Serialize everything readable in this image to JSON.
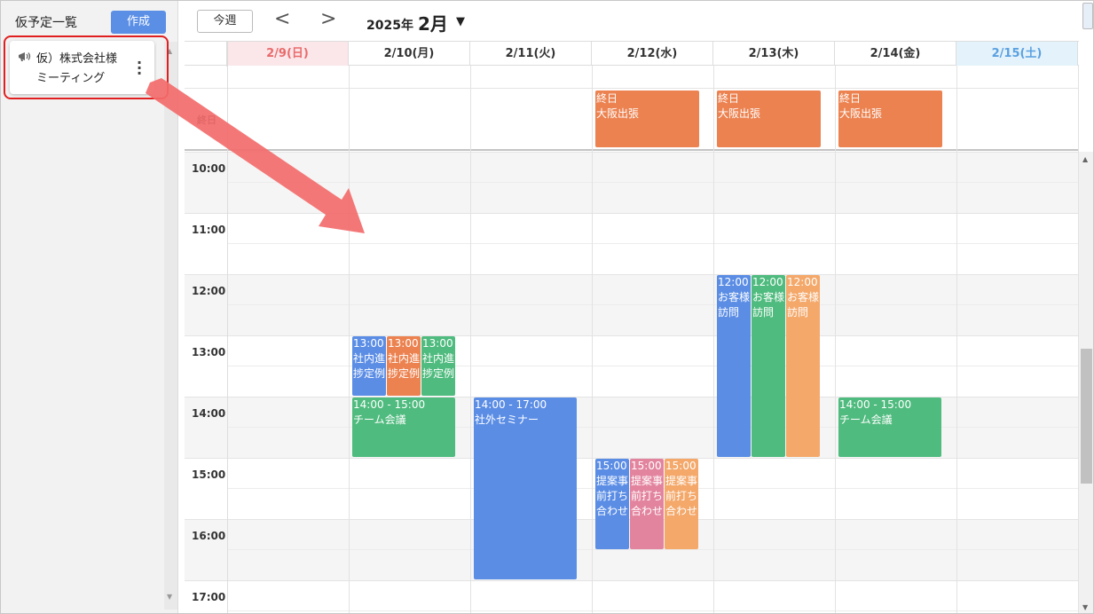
{
  "sidebar": {
    "title": "仮予定一覧",
    "create_label": "作成",
    "tentative": {
      "line1": "仮）株式会社様",
      "line2": "ミーティング",
      "icon": "megaphone-icon",
      "menu_icon": "more-vertical-icon"
    }
  },
  "toolbar": {
    "today_label": "今週",
    "prev_label": "<",
    "next_label": ">",
    "year_label": "2025年",
    "month_label": "2月",
    "caret": "▼"
  },
  "calendar": {
    "allday_label": "終日",
    "days": [
      {
        "label": "2/9(日)",
        "kind": "sun"
      },
      {
        "label": "2/10(月)",
        "kind": ""
      },
      {
        "label": "2/11(火)",
        "kind": ""
      },
      {
        "label": "2/12(水)",
        "kind": ""
      },
      {
        "label": "2/13(木)",
        "kind": ""
      },
      {
        "label": "2/14(金)",
        "kind": ""
      },
      {
        "label": "2/15(土)",
        "kind": "sat"
      }
    ],
    "hours": [
      "10:00",
      "11:00",
      "12:00",
      "13:00",
      "14:00",
      "15:00",
      "16:00",
      "17:00"
    ],
    "allday_events": [
      {
        "day": 3,
        "line1": "終日",
        "line2": "大阪出張"
      },
      {
        "day": 4,
        "line1": "終日",
        "line2": "大阪出張"
      },
      {
        "day": 5,
        "line1": "終日",
        "line2": "大阪出張"
      }
    ],
    "events": [
      {
        "day": 1,
        "start": 13,
        "end": 14,
        "col": 0,
        "cols": 3,
        "lines": [
          "13:00",
          "社内進",
          "捗定例"
        ],
        "color": "#5b8de5"
      },
      {
        "day": 1,
        "start": 13,
        "end": 14,
        "col": 1,
        "cols": 3,
        "lines": [
          "13:00",
          "社内進",
          "捗定例"
        ],
        "color": "#ec8250"
      },
      {
        "day": 1,
        "start": 13,
        "end": 14,
        "col": 2,
        "cols": 3,
        "lines": [
          "13:00",
          "社内進",
          "捗定例"
        ],
        "color": "#4fbb7e"
      },
      {
        "day": 1,
        "start": 14,
        "end": 15,
        "col": 0,
        "cols": 1,
        "lines": [
          "14:00 - 15:00",
          "チーム会議"
        ],
        "color": "#4fbb7e"
      },
      {
        "day": 2,
        "start": 14,
        "end": 17,
        "col": 0,
        "cols": 1,
        "lines": [
          "14:00 - 17:00",
          "社外セミナー"
        ],
        "color": "#5b8de5"
      },
      {
        "day": 3,
        "start": 15,
        "end": 16.5,
        "col": 0,
        "cols": 3,
        "lines": [
          "15:00",
          "提案事",
          "前打ち",
          "合わせ"
        ],
        "color": "#5b8de5"
      },
      {
        "day": 3,
        "start": 15,
        "end": 16.5,
        "col": 1,
        "cols": 3,
        "lines": [
          "15:00",
          "提案事",
          "前打ち",
          "合わせ"
        ],
        "color": "#e3849f"
      },
      {
        "day": 3,
        "start": 15,
        "end": 16.5,
        "col": 2,
        "cols": 3,
        "lines": [
          "15:00",
          "提案事",
          "前打ち",
          "合わせ"
        ],
        "color": "#f4a86a"
      },
      {
        "day": 4,
        "start": 12,
        "end": 15,
        "col": 0,
        "cols": 3,
        "lines": [
          "12:00",
          "お客様",
          "訪問"
        ],
        "color": "#5b8de5"
      },
      {
        "day": 4,
        "start": 12,
        "end": 15,
        "col": 1,
        "cols": 3,
        "lines": [
          "12:00",
          "お客様",
          "訪問"
        ],
        "color": "#4fbb7e"
      },
      {
        "day": 4,
        "start": 12,
        "end": 15,
        "col": 2,
        "cols": 3,
        "lines": [
          "12:00",
          "お客様",
          "訪問"
        ],
        "color": "#f4a86a"
      },
      {
        "day": 5,
        "start": 14,
        "end": 15,
        "col": 0,
        "cols": 1,
        "lines": [
          "14:00 - 15:00",
          "チーム会議"
        ],
        "color": "#4fbb7e"
      }
    ]
  },
  "annotation": {
    "highlight_color": "#e02020",
    "arrow_color": "#f36b6b"
  }
}
